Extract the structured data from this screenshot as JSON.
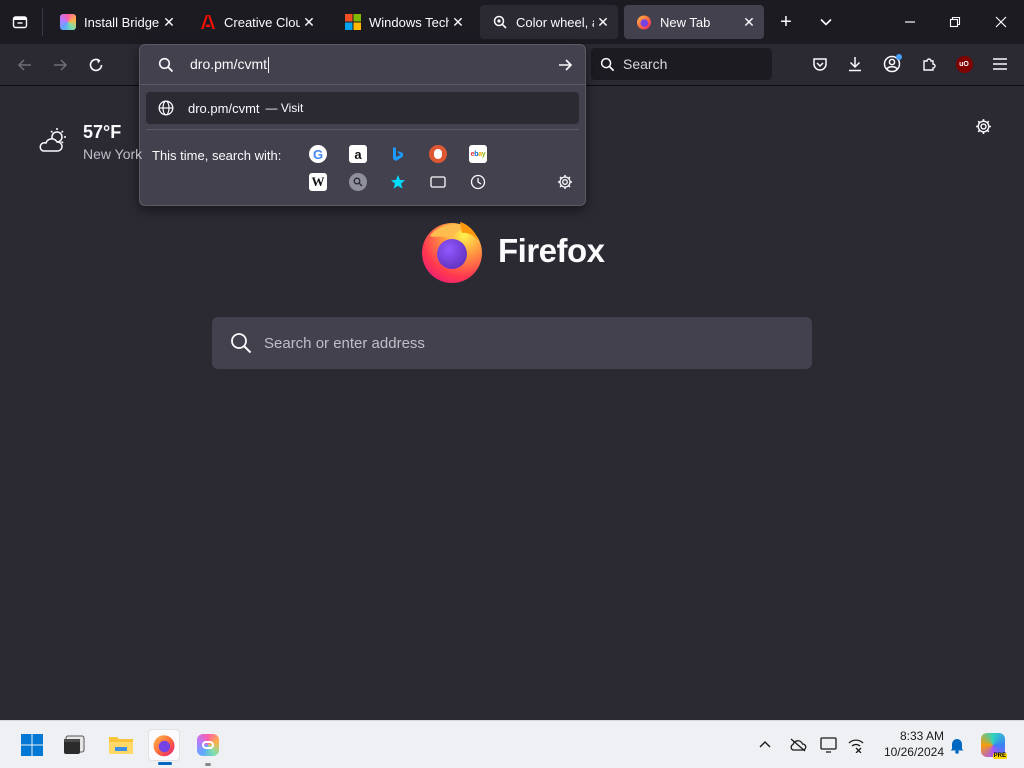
{
  "browser": {
    "tabs": [
      {
        "title": "Install Bridge | Ad",
        "favicon": "adobe-cc-icon"
      },
      {
        "title": "Creative Cloud: C",
        "favicon": "adobe-icon"
      },
      {
        "title": "Windows Technic",
        "favicon": "windows-icon"
      },
      {
        "title": "Color wheel, a",
        "favicon": "color-wheel-icon"
      },
      {
        "title": "New Tab",
        "favicon": "firefox-icon"
      }
    ],
    "search_placeholder": "Search",
    "url_value": "dro.pm/cvmt"
  },
  "urlbar_dropdown": {
    "result_url": "dro.pm/cvmt",
    "result_action": "— Visit",
    "oneoff_label": "This time, search with:",
    "engines_row1": [
      "Google",
      "Amazon",
      "Bing",
      "DuckDuckGo",
      "eBay"
    ],
    "engines_row2": [
      "Wikipedia",
      "Search",
      "Bookmarks",
      "Tabs",
      "History"
    ]
  },
  "newtab": {
    "weather_temp": "57°F",
    "weather_location": "New York",
    "brand_name": "Firefox",
    "search_placeholder": "Search or enter address"
  },
  "taskbar": {
    "time": "8:33 AM",
    "date": "10/26/2024",
    "apps": [
      "start",
      "terminal",
      "file-explorer",
      "firefox",
      "creative-cloud"
    ]
  },
  "colors": {
    "tabbar_bg": "#1c1b22",
    "content_bg": "#2b2a33",
    "panel_bg": "#42414d",
    "taskbar_bg": "#eef0f4",
    "accent": "#0060df"
  }
}
